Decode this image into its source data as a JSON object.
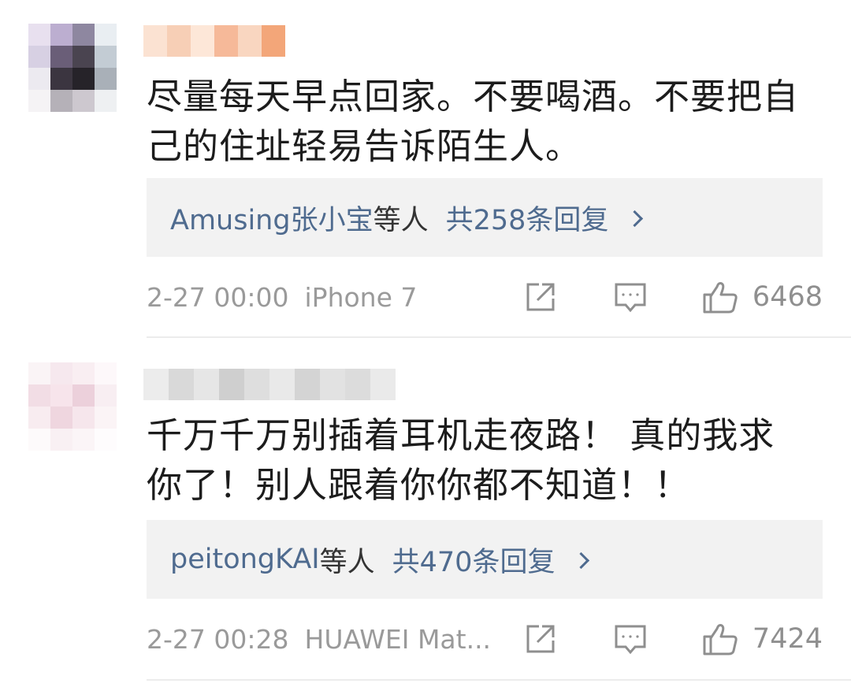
{
  "comments": [
    {
      "text": "尽量每天早点回家。不要喝酒。不要把自己的住址轻易告诉陌生人。",
      "reply_users": "Amusing张小宝",
      "reply_suffix": "等人",
      "reply_count": "共258条回复",
      "time": "2-27 00:00",
      "device": "iPhone 7",
      "likes": "6468",
      "icons": {
        "share": "share-icon",
        "comment": "comment-icon",
        "like": "thumbs-up-icon",
        "chevron": "chevron-right-icon"
      },
      "avatar_colors": [
        "#e8e0ef",
        "#bcaed0",
        "#8e87a0",
        "#e9eef2",
        "#d7d0e3",
        "#6a5e78",
        "#4a4450",
        "#c3ccd4",
        "#eceaf0",
        "#3b3540",
        "#262329",
        "#a9b0b8",
        "#f5f3f5",
        "#b5b1b8",
        "#cdc8cf",
        "#eef0f2"
      ],
      "username_colors": [
        "#fbe2d2",
        "#f7cfb6",
        "#fde7d8",
        "#f6b999",
        "#f9d6c0",
        "#f3a679"
      ]
    },
    {
      "text": "千万千万别插着耳机走夜路！ 真的我求你了！别人跟着你你都不知道！！",
      "reply_users": "peitongKAI",
      "reply_suffix": "等人",
      "reply_count": "共470条回复",
      "time": "2-27 00:28",
      "device": "HUAWEI Mat...",
      "likes": "7424",
      "icons": {
        "share": "share-icon",
        "comment": "comment-icon",
        "like": "thumbs-up-icon",
        "chevron": "chevron-right-icon"
      },
      "avatar_colors": [
        "#faf4f6",
        "#f6e8ee",
        "#f9eef2",
        "#fdf8fa",
        "#f2dde5",
        "#f7e4eb",
        "#ecd0db",
        "#f8eef2",
        "#f8ecf0",
        "#efd6df",
        "#f6e6ec",
        "#fbf4f6",
        "#fdfafb",
        "#f9f0f3",
        "#fbf5f7",
        "#fefcfd"
      ],
      "username_colors": [
        "#ececec",
        "#d9d9d9",
        "#e6e6e6",
        "#cfcfcf",
        "#dedede",
        "#e9e9e9",
        "#d4d4d4",
        "#e2e2e2",
        "#dcdcdc",
        "#eaeaea"
      ]
    }
  ]
}
